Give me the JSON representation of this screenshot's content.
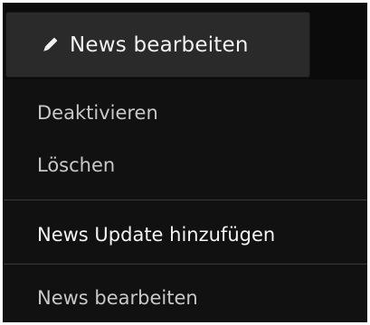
{
  "trigger": {
    "icon": "pencil-icon",
    "label": "News bearbeiten"
  },
  "menu": {
    "items": [
      {
        "label": "Deaktivieren"
      },
      {
        "label": "Löschen"
      },
      {
        "label": "News Update hinzufügen"
      },
      {
        "label": "News bearbeiten"
      }
    ]
  },
  "colors": {
    "background": "#0b0b0b",
    "button": "#2a2a2a",
    "text": "#f2f2f2",
    "muted_text": "#c8c8c8",
    "divider": "#3a3a3a"
  }
}
